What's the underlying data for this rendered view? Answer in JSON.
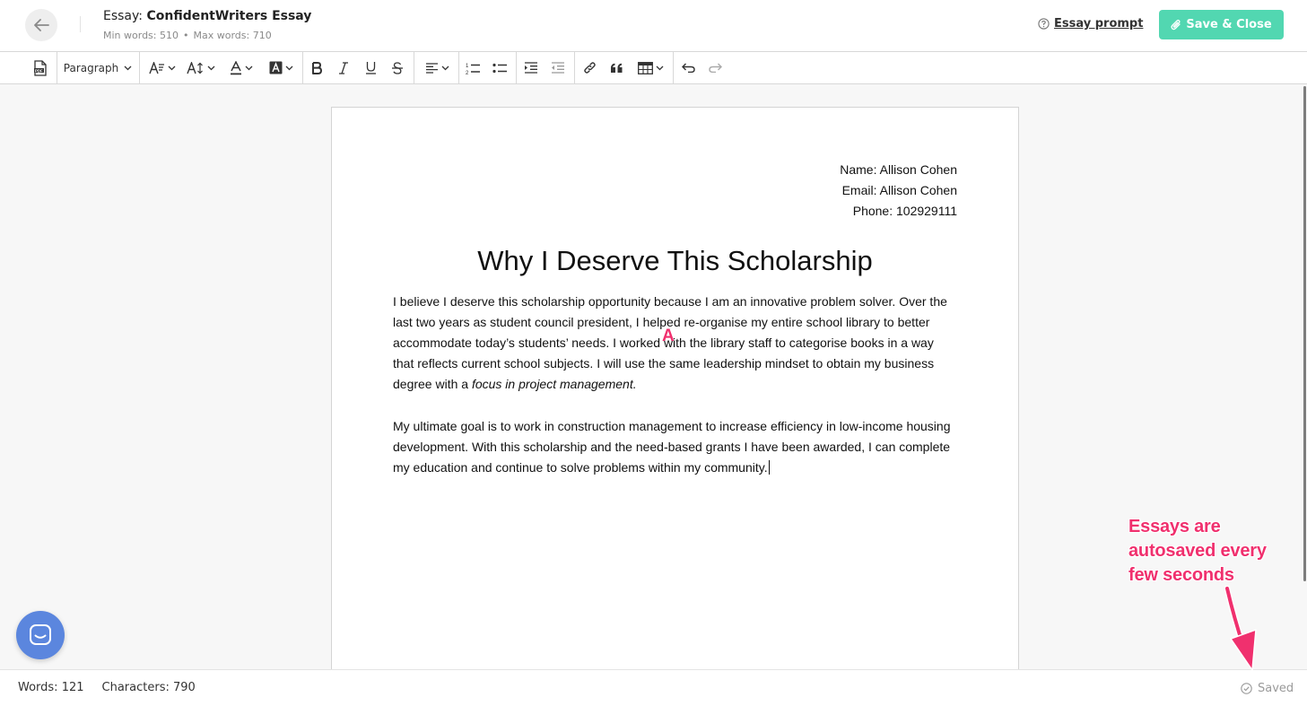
{
  "header": {
    "title_prefix": "Essay:",
    "title_name": "ConfidentWriters Essay",
    "min_words": "Min words: 510",
    "separator": "•",
    "max_words": "Max words: 710",
    "prompt_link": "Essay prompt",
    "save_button": "Save & Close",
    "accent_color": "#52d7b1"
  },
  "toolbar": {
    "items": [
      {
        "name": "export-pdf-button",
        "icon": "pdf-icon"
      },
      {
        "name": "paragraph-dropdown",
        "label": "Paragraph"
      },
      {
        "name": "font-style-dropdown",
        "icon": "text-style-icon"
      },
      {
        "name": "font-size-dropdown",
        "icon": "font-size-icon"
      },
      {
        "name": "font-color-dropdown",
        "icon": "font-color-icon"
      },
      {
        "name": "highlight-dropdown",
        "icon": "highlight-icon"
      },
      {
        "name": "bold-button",
        "icon": "bold-icon"
      },
      {
        "name": "italic-button",
        "icon": "italic-icon"
      },
      {
        "name": "underline-button",
        "icon": "underline-icon"
      },
      {
        "name": "strikethrough-button",
        "icon": "strikethrough-icon"
      },
      {
        "name": "align-dropdown",
        "icon": "align-left-icon"
      },
      {
        "name": "numbered-list-button",
        "icon": "numbered-list-icon"
      },
      {
        "name": "bulleted-list-button",
        "icon": "bulleted-list-icon"
      },
      {
        "name": "indent-button",
        "icon": "indent-icon"
      },
      {
        "name": "outdent-button",
        "icon": "outdent-icon"
      },
      {
        "name": "link-button",
        "icon": "link-icon"
      },
      {
        "name": "blockquote-button",
        "icon": "quote-icon"
      },
      {
        "name": "table-dropdown",
        "icon": "table-icon"
      },
      {
        "name": "undo-button",
        "icon": "undo-icon"
      },
      {
        "name": "redo-button",
        "icon": "redo-icon"
      }
    ]
  },
  "document": {
    "contact": {
      "name": "Name: Allison Cohen",
      "email": "Email: Allison Cohen",
      "phone": "Phone: 102929111"
    },
    "heading": "Why I Deserve This Scholarship",
    "paragraph1_text": "I believe I deserve this scholarship opportunity because I am an innovative problem solver. Over the last two years as student council president, I helped re-organise my entire school library to better accommodate today’s students’ needs. I worked with the library staff to categorise books in a way that reflects current school subjects. I will use the same leadership mindset to obtain my business degree with a ",
    "paragraph1_italic": "focus in project management.",
    "paragraph2": "My ultimate goal is to work in construction management to increase efficiency in low-income housing development. With this scholarship and the need-based grants I have been awarded, I can complete my education and continue to solve problems within my community.",
    "marker": "A"
  },
  "status": {
    "words": "Words: 121",
    "characters": "Characters: 790",
    "saved": "Saved"
  },
  "annotation": {
    "text": "Essays are autosaved every few seconds",
    "line1": "Essays are",
    "line2": "autosaved every",
    "line3": "few seconds",
    "color": "#f0306e"
  },
  "chat": {
    "icon": "chat-icon",
    "color": "#5b86de"
  }
}
